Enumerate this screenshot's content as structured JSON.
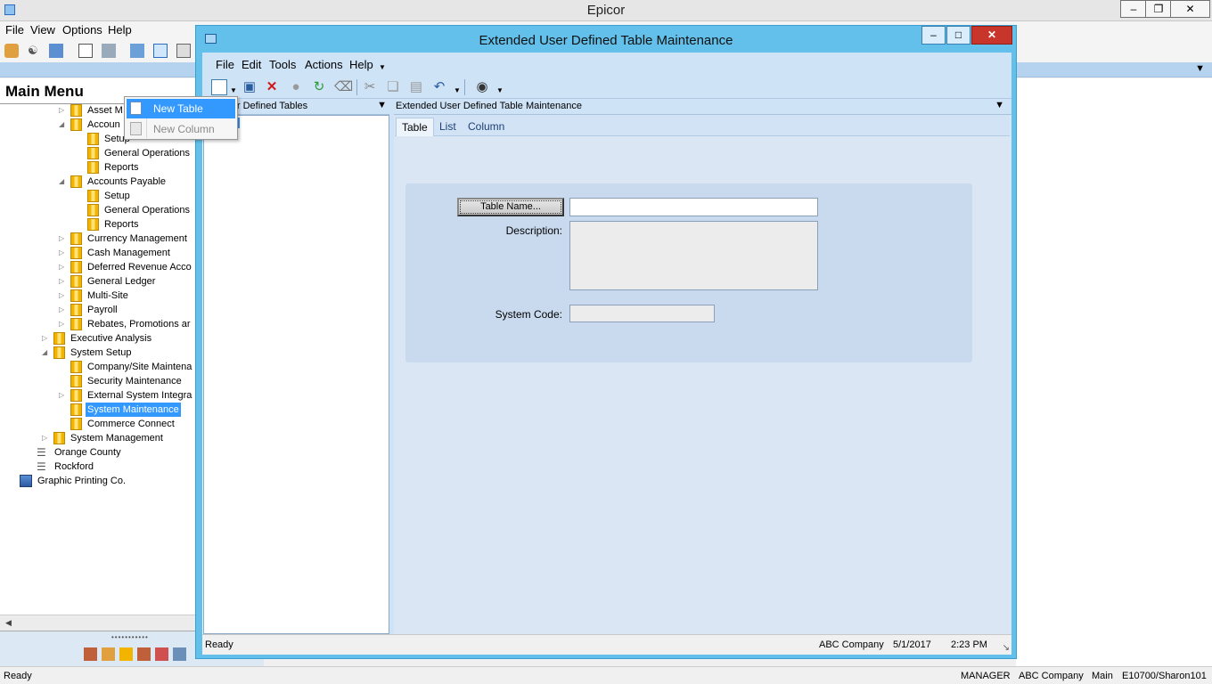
{
  "app": {
    "title": "Epicor",
    "menu": [
      "File",
      "View",
      "Options",
      "Help"
    ],
    "status": {
      "left": "Ready",
      "user": "MANAGER",
      "company": "ABC Company",
      "site": "Main",
      "version": "E10700/Sharon101"
    }
  },
  "main_menu": {
    "title": "Main Menu",
    "tree": [
      {
        "label": "Asset M",
        "expander": "collapsed",
        "icon": "folder-icon"
      },
      {
        "label": "Accoun",
        "expander": "expanded",
        "icon": "folder-icon"
      },
      {
        "label": "Setup",
        "expander": "",
        "icon": "folder-icon"
      },
      {
        "label": "General Operations",
        "expander": "",
        "icon": "folder-icon"
      },
      {
        "label": "Reports",
        "expander": "",
        "icon": "folder-icon"
      },
      {
        "label": "Accounts Payable",
        "expander": "expanded",
        "icon": "folder-icon"
      },
      {
        "label": "Setup",
        "expander": "",
        "icon": "folder-icon"
      },
      {
        "label": "General Operations",
        "expander": "",
        "icon": "folder-icon"
      },
      {
        "label": "Reports",
        "expander": "",
        "icon": "folder-icon"
      },
      {
        "label": "Currency Management",
        "expander": "collapsed",
        "icon": "folder-icon"
      },
      {
        "label": "Cash Management",
        "expander": "collapsed",
        "icon": "folder-icon"
      },
      {
        "label": "Deferred Revenue Acco",
        "expander": "collapsed",
        "icon": "folder-icon"
      },
      {
        "label": "General Ledger",
        "expander": "collapsed",
        "icon": "folder-icon"
      },
      {
        "label": "Multi-Site",
        "expander": "collapsed",
        "icon": "folder-icon"
      },
      {
        "label": "Payroll",
        "expander": "collapsed",
        "icon": "folder-icon"
      },
      {
        "label": "Rebates, Promotions ar",
        "expander": "collapsed",
        "icon": "folder-icon"
      },
      {
        "label": "Executive Analysis",
        "expander": "collapsed",
        "icon": "folder-icon"
      },
      {
        "label": "System Setup",
        "expander": "expanded",
        "icon": "folder-icon"
      },
      {
        "label": "Company/Site Maintena",
        "expander": "",
        "icon": "folder-icon"
      },
      {
        "label": "Security Maintenance",
        "expander": "",
        "icon": "folder-icon"
      },
      {
        "label": "External System Integra",
        "expander": "collapsed",
        "icon": "folder-icon"
      },
      {
        "label": "System Maintenance",
        "expander": "",
        "icon": "folder-open-icon",
        "selected": true
      },
      {
        "label": "Commerce Connect",
        "expander": "",
        "icon": "folder-icon"
      },
      {
        "label": "System Management",
        "expander": "collapsed",
        "icon": "folder-icon"
      },
      {
        "label": "Orange County",
        "expander": "",
        "icon": "network-icon"
      },
      {
        "label": "Rockford",
        "expander": "",
        "icon": "network-icon"
      },
      {
        "label": "Graphic Printing Co.",
        "expander": "",
        "icon": "building-icon"
      }
    ]
  },
  "dialog": {
    "title": "Extended User Defined Table Maintenance",
    "menu": [
      "File",
      "Edit",
      "Tools",
      "Actions",
      "Help"
    ],
    "tree_pane_title": "ed User Defined Tables",
    "tree_node": "les",
    "content_title": "Extended User Defined Table Maintenance",
    "tabs": [
      "Table",
      "List",
      "Column"
    ],
    "active_tab": "Table",
    "form": {
      "table_name_button": "Table Name...",
      "table_name_value": "",
      "description_label": "Description:",
      "description_value": "",
      "system_code_label": "System Code:",
      "system_code_value": ""
    },
    "status": {
      "left": "Ready",
      "company": "ABC Company",
      "date": "5/1/2017",
      "time": "2:23 PM"
    }
  },
  "new_menu": {
    "items": [
      {
        "label": "New Table",
        "enabled": true,
        "highlighted": true
      },
      {
        "label": "New Column",
        "enabled": false
      }
    ]
  },
  "colors": {
    "dialog_frame": "#62c0ea",
    "selection": "#3399ff",
    "close_button": "#c8352b"
  }
}
